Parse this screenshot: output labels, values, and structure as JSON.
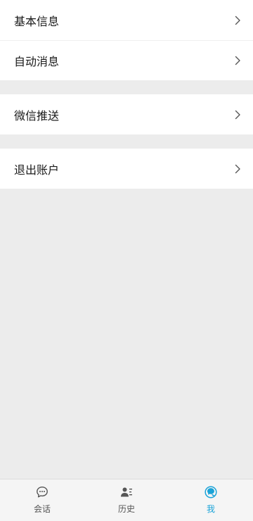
{
  "menu": {
    "groups": [
      {
        "items": [
          {
            "label": "基本信息"
          },
          {
            "label": "自动消息"
          }
        ]
      },
      {
        "items": [
          {
            "label": "微信推送"
          }
        ]
      },
      {
        "items": [
          {
            "label": "退出账户"
          }
        ]
      }
    ]
  },
  "tabbar": {
    "tabs": [
      {
        "label": "会话",
        "icon": "chat-bubble-icon",
        "active": false
      },
      {
        "label": "历史",
        "icon": "contacts-list-icon",
        "active": false
      },
      {
        "label": "我",
        "icon": "me-icon",
        "active": true
      }
    ],
    "colors": {
      "active": "#1aa3d8",
      "inactive": "#555555"
    }
  }
}
